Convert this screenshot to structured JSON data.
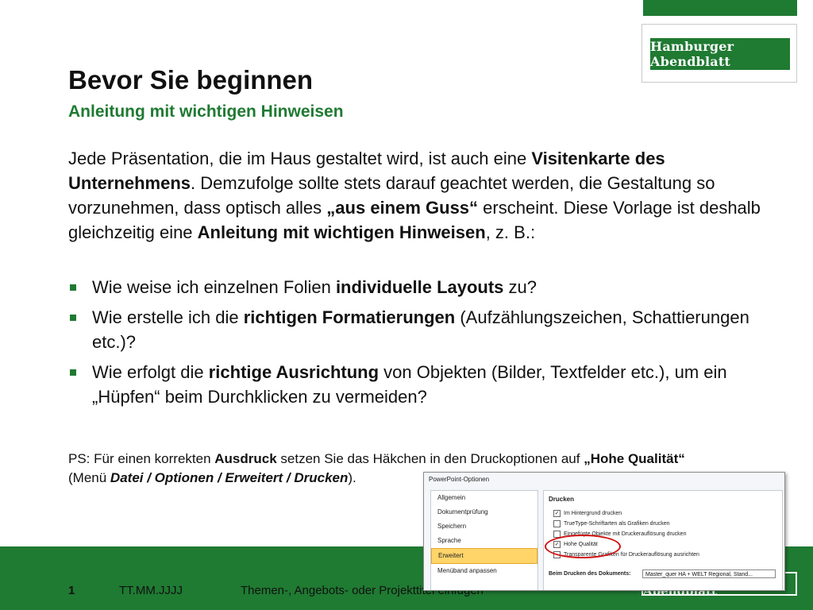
{
  "header": {
    "logo_text": "Hamburger Abendblatt"
  },
  "title": "Bevor Sie beginnen",
  "subtitle": "Anleitung mit wichtigen Hinweisen",
  "intro": [
    {
      "text": "Jede Präsentation, die im Haus gestaltet wird, ist auch eine ",
      "bold": false
    },
    {
      "text": "Visitenkarte des Unternehmens",
      "bold": true
    },
    {
      "text": ". Demzufolge sollte stets darauf geachtet werden, die Gestaltung so vorzunehmen, dass optisch alles ",
      "bold": false
    },
    {
      "text": "„aus einem Guss“",
      "bold": true
    },
    {
      "text": " erscheint. Diese Vorlage ist deshalb gleichzeitig eine ",
      "bold": false
    },
    {
      "text": "Anleitung mit wichtigen Hinweisen",
      "bold": true
    },
    {
      "text": ", z. B.:",
      "bold": false
    }
  ],
  "bullets": [
    [
      {
        "text": "Wie weise ich einzelnen Folien ",
        "bold": false
      },
      {
        "text": "individuelle Layouts",
        "bold": true
      },
      {
        "text": " zu?",
        "bold": false
      }
    ],
    [
      {
        "text": "Wie erstelle ich die ",
        "bold": false
      },
      {
        "text": "richtigen Formatierungen",
        "bold": true
      },
      {
        "text": " (Aufzählungszeichen, Schattierungen etc.)?",
        "bold": false
      }
    ],
    [
      {
        "text": "Wie erfolgt die ",
        "bold": false
      },
      {
        "text": "richtige Ausrichtung",
        "bold": true
      },
      {
        "text": " von Objekten (Bilder, Textfelder etc.), um ein „Hüpfen“ beim Durchklicken zu vermeiden?",
        "bold": false
      }
    ]
  ],
  "ps": [
    {
      "text": "PS: Für einen korrekten ",
      "bold": false,
      "italic": false
    },
    {
      "text": "Ausdruck",
      "bold": true,
      "italic": false
    },
    {
      "text": " setzen Sie das Häkchen in den Druckoptionen auf ",
      "bold": false,
      "italic": false
    },
    {
      "text": "„Hohe Qualität“",
      "bold": true,
      "italic": false
    },
    {
      "text": "(Menü ",
      "bold": false,
      "italic": false,
      "break_before": true
    },
    {
      "text": "Datei / Optionen / Erweitert / Drucken",
      "bold": true,
      "italic": true
    },
    {
      "text": ").",
      "bold": false,
      "italic": false
    }
  ],
  "dialog": {
    "window_title": "PowerPoint-Optionen",
    "sidebar_items": [
      "Allgemein",
      "Dokumentprüfung",
      "Speichern",
      "Sprache",
      "Erweitert",
      "Menüband anpassen"
    ],
    "active_item": "Erweitert",
    "section_title": "Drucken",
    "options": [
      {
        "label": "Im Hintergrund drucken",
        "checked": true
      },
      {
        "label": "TrueType-Schriftarten als Grafiken drucken",
        "checked": false
      },
      {
        "label": "Eingefügte Objekte mit Druckerauflösung drucken",
        "checked": false
      },
      {
        "label": "Hohe Qualität",
        "checked": true
      },
      {
        "label": "Transparente Grafiken für Druckerauflösung ausrichten",
        "checked": false
      }
    ],
    "doc_print_label": "Beim Drucken des Dokuments:",
    "doc_select_value": "Master_quer HA + WELT Regional, Stand..."
  },
  "footer": {
    "page_number": "1",
    "date": "TT.MM.JJJJ",
    "topic": "Themen-, Angebots- oder Projekttitel einfügen",
    "logo_text": "Hamburger Abendblatt"
  },
  "colors": {
    "brand_green": "#1f7a32",
    "highlight_red": "#d01010"
  }
}
